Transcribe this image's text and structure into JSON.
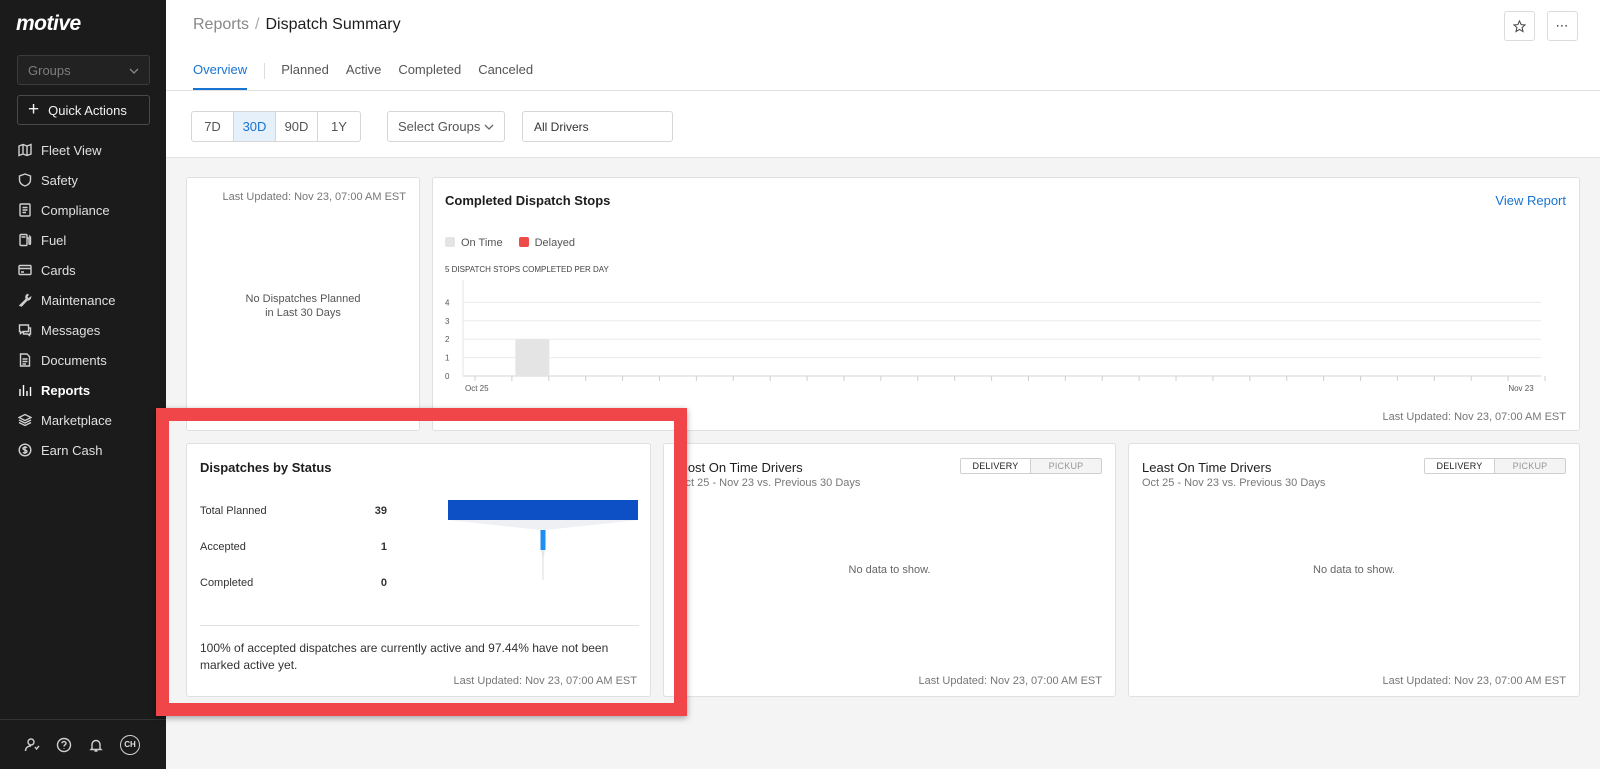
{
  "brand": {
    "logo_text": "motive"
  },
  "sidebar": {
    "groups_placeholder": "Groups",
    "quick_actions_label": "Quick Actions",
    "items": [
      {
        "label": "Fleet View",
        "icon": "map-icon"
      },
      {
        "label": "Safety",
        "icon": "shield-icon"
      },
      {
        "label": "Compliance",
        "icon": "checklist-icon"
      },
      {
        "label": "Fuel",
        "icon": "fuel-icon"
      },
      {
        "label": "Cards",
        "icon": "card-icon"
      },
      {
        "label": "Maintenance",
        "icon": "wrench-icon"
      },
      {
        "label": "Messages",
        "icon": "message-icon"
      },
      {
        "label": "Documents",
        "icon": "document-icon"
      },
      {
        "label": "Reports",
        "icon": "reports-icon",
        "active": true
      },
      {
        "label": "Marketplace",
        "icon": "layers-icon"
      },
      {
        "label": "Earn Cash",
        "icon": "dollar-icon"
      }
    ],
    "avatar_initials": "CH"
  },
  "header": {
    "breadcrumb_root": "Reports",
    "breadcrumb_separator": "/",
    "title": "Dispatch Summary",
    "tabs": [
      "Overview",
      "Planned",
      "Active",
      "Completed",
      "Canceled"
    ],
    "active_tab": "Overview"
  },
  "filters": {
    "ranges": [
      "7D",
      "30D",
      "90D",
      "1Y"
    ],
    "selected_range": "30D",
    "groups_select": "Select Groups",
    "drivers_value": "All Drivers"
  },
  "planned_card": {
    "updated": "Last Updated: Nov 23, 07:00 AM EST",
    "empty_line1": "No Dispatches Planned",
    "empty_line2": "in Last 30 Days"
  },
  "stops_card": {
    "title": "Completed Dispatch Stops",
    "view_report": "View Report",
    "updated": "Last Updated: Nov 23, 07:00 AM EST",
    "colors": {
      "on_time": "#e4e4e4",
      "delayed": "#ef4b48"
    }
  },
  "chart_data": {
    "type": "bar",
    "title": "Completed Dispatch Stops",
    "subtitle": "5 DISPATCH STOPS COMPLETED PER DAY",
    "series": [
      {
        "name": "On Time",
        "values": [
          0,
          2,
          0,
          0,
          0,
          0,
          0,
          0,
          0,
          0,
          0,
          0,
          0,
          0,
          0,
          0,
          0,
          0,
          0,
          0,
          0,
          0,
          0,
          0,
          0,
          0,
          0,
          0,
          0,
          0
        ]
      },
      {
        "name": "Delayed",
        "values": [
          0,
          0,
          0,
          0,
          0,
          0,
          0,
          0,
          0,
          0,
          0,
          0,
          0,
          0,
          0,
          0,
          0,
          0,
          0,
          0,
          0,
          0,
          0,
          0,
          0,
          0,
          0,
          0,
          0,
          0
        ]
      }
    ],
    "x_tick_labels": [
      "Oct 25",
      "Nov 23"
    ],
    "y_ticks": [
      0,
      1,
      2,
      3,
      4
    ],
    "ylim": [
      0,
      5
    ],
    "grid": true,
    "legend_position": "top-left"
  },
  "status_card": {
    "title": "Dispatches by Status",
    "rows": [
      {
        "label": "Total Planned",
        "value": "39"
      },
      {
        "label": "Accepted",
        "value": "1"
      },
      {
        "label": "Completed",
        "value": "0"
      }
    ],
    "funnel_values": [
      39,
      1,
      0
    ],
    "summary": "100% of accepted dispatches are currently active and 97.44% have not been marked active yet.",
    "updated": "Last Updated: Nov 23, 07:00 AM EST",
    "colors": {
      "planned": "#0d4fc5",
      "accepted": "#1e8ef2"
    }
  },
  "most_on_time": {
    "title": "Most On Time Drivers",
    "subtitle": "Oct 25 - Nov 23 vs. Previous 30 Days",
    "toggle": [
      "DELIVERY",
      "PICKUP"
    ],
    "empty": "No data to show.",
    "updated": "Last Updated: Nov 23, 07:00 AM EST"
  },
  "least_on_time": {
    "title": "Least On Time Drivers",
    "subtitle": "Oct 25 - Nov 23 vs. Previous 30 Days",
    "toggle": [
      "DELIVERY",
      "PICKUP"
    ],
    "empty": "No data to show.",
    "updated": "Last Updated: Nov 23, 07:00 AM EST"
  },
  "highlight_color": "#f0464a"
}
